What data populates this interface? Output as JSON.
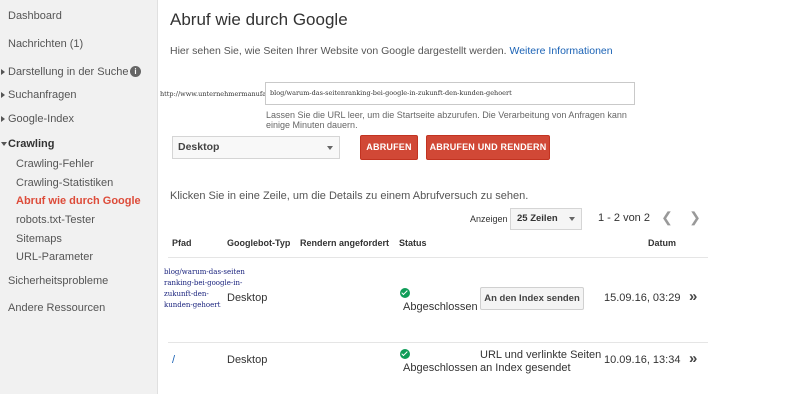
{
  "sidebar": {
    "dashboard": "Dashboard",
    "messages": "Nachrichten (1)",
    "search_appearance": "Darstellung in der Suche",
    "search_traffic": "Suchanfragen",
    "google_index": "Google-Index",
    "crawl": "Crawling",
    "crawl_errors": "Crawling-Fehler",
    "crawl_stats": "Crawling-Statistiken",
    "fetch_as_google": "Abruf wie durch Google",
    "robots_tester": "robots.txt-Tester",
    "sitemaps": "Sitemaps",
    "url_params": "URL-Parameter",
    "security": "Sicherheitsprobleme",
    "other_resources": "Andere Ressourcen"
  },
  "main": {
    "title": "Abruf wie durch Google",
    "intro": "Hier sehen Sie, wie Seiten Ihrer Website von Google dargestellt werden.",
    "intro_link": "Weitere Informationen",
    "domain_prefix": "http://www.unternehmermanufaktur.com/",
    "url_value": "blog/warum-das-seitenranking-bei-google-in-zukunft-den-kunden-gehoert",
    "hint": "Lassen Sie die URL leer, um die Startseite abzurufen. Die Verarbeitung von Anfragen kann einige Minuten dauern.",
    "device_value": "Desktop",
    "fetch_button": "ABRUFEN",
    "fetch_render_button": "ABRUFEN UND RENDERN",
    "click_hint": "Klicken Sie in eine Zeile, um die Details zu einem Abrufversuch zu sehen."
  },
  "pager": {
    "show_label": "Anzeigen",
    "rows_value": "25 Zeilen",
    "range": "1 - 2 von 2"
  },
  "table": {
    "headers": {
      "path": "Pfad",
      "googlebot": "Googlebot-Typ",
      "render": "Rendern angefordert",
      "status": "Status",
      "date": "Datum"
    },
    "rows": [
      {
        "path_lines": [
          "blog/warum-das-seiten",
          "ranking-bei-google-in-",
          "zukunft-den-",
          "kunden-gehoert"
        ],
        "googlebot": "Desktop",
        "status": "Abgeschlossen",
        "action": "An den Index senden",
        "date": "15.09.16, 03:29"
      },
      {
        "path": "/",
        "googlebot": "Desktop",
        "status": "Abgeschlossen",
        "action_lines": [
          "URL und verlinkte Seiten",
          "an Index gesendet"
        ],
        "date": "10.09.16, 13:34"
      }
    ]
  },
  "colors": {
    "accent_red": "#d14836",
    "link_blue": "#1a62b5",
    "success_green": "#0f9d58"
  }
}
